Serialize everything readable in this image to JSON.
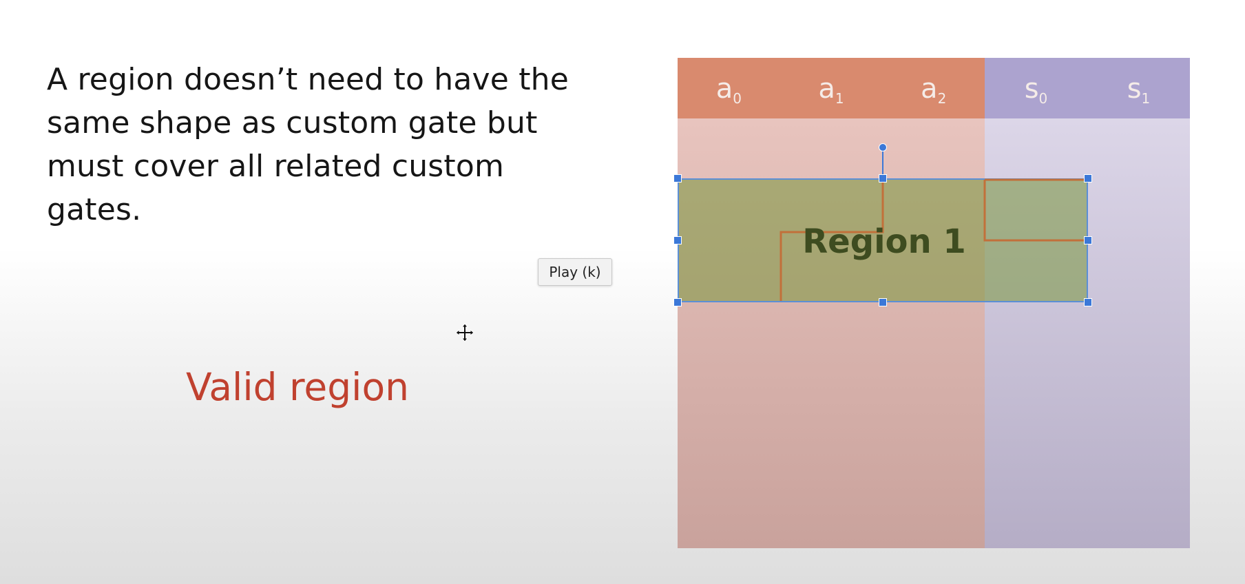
{
  "slide": {
    "text_lines": [
      "A region doesn’t need to have the",
      "same shape as custom gate but",
      "must cover all related custom",
      "gates."
    ],
    "caption": "Valid region"
  },
  "tooltip": {
    "label": "Play (k)"
  },
  "table": {
    "advice_columns": [
      {
        "base": "a",
        "sub": "0"
      },
      {
        "base": "a",
        "sub": "1"
      },
      {
        "base": "a",
        "sub": "2"
      }
    ],
    "selector_columns": [
      {
        "base": "s",
        "sub": "0"
      },
      {
        "base": "s",
        "sub": "1"
      }
    ],
    "region_label": "Region 1"
  },
  "colors": {
    "advice_header": "#d98a6e",
    "selector_header": "#aca3cf",
    "region_fill": "#78963c",
    "selection_handle": "#3b78d8",
    "caption": "#c0412f"
  },
  "icons": {
    "cursor": "move-cursor-icon"
  }
}
